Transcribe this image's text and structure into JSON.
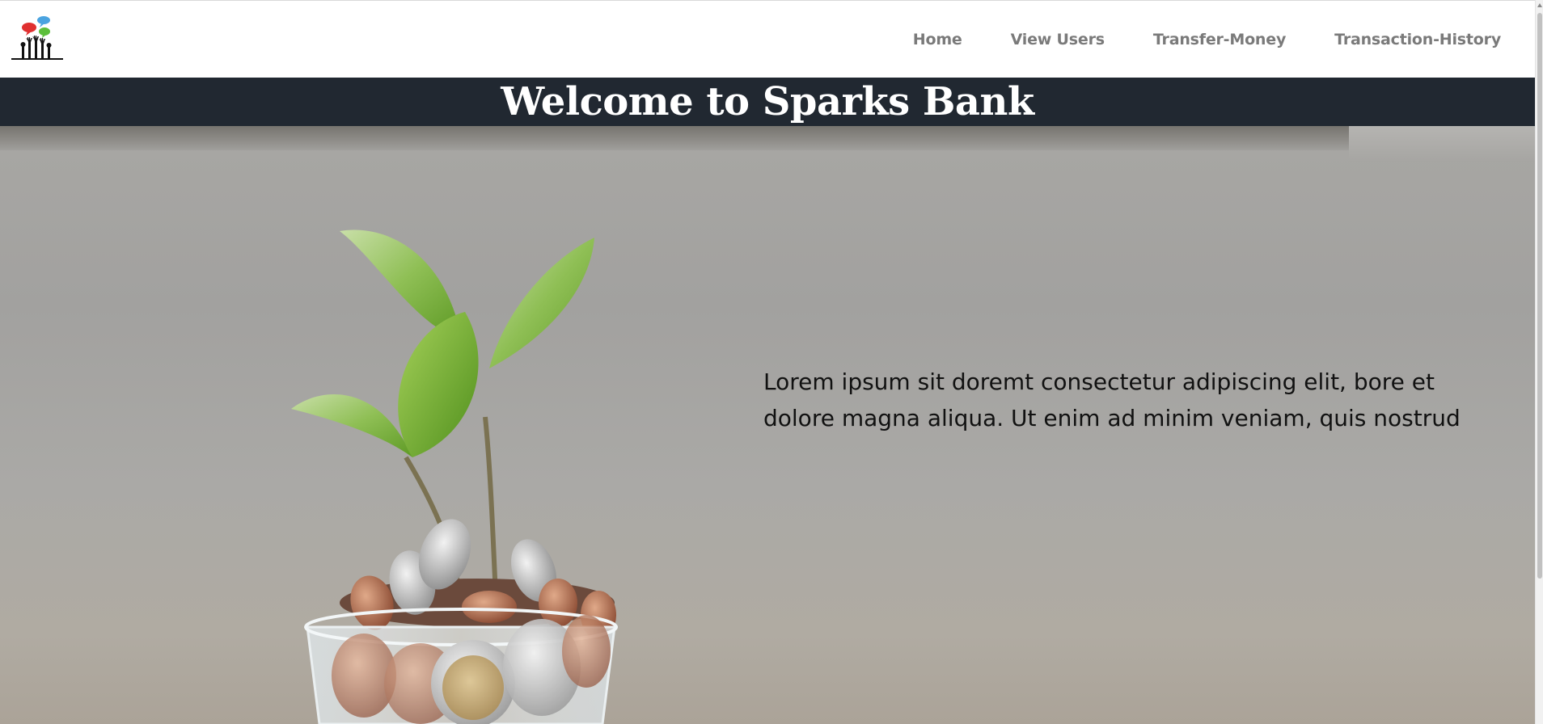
{
  "navbar": {
    "logo_icon": "community-hands-speech-bubbles-logo",
    "links": [
      {
        "label": "Home"
      },
      {
        "label": "View Users"
      },
      {
        "label": "Transfer-Money"
      },
      {
        "label": "Transaction-History"
      }
    ]
  },
  "title_band": {
    "title": "Welcome to Sparks Bank",
    "background": "#212831"
  },
  "hero": {
    "image": "plant-sprouting-from-coins-in-glass",
    "text": "Lorem ipsum sit doremt consectetur adipiscing elit, bore et dolore magna aliqua. Ut enim ad minim veniam, quis nostrud"
  },
  "colors": {
    "nav_link": "#7a7a7a",
    "band": "#212831",
    "leaf_green": "#6aa52b"
  }
}
